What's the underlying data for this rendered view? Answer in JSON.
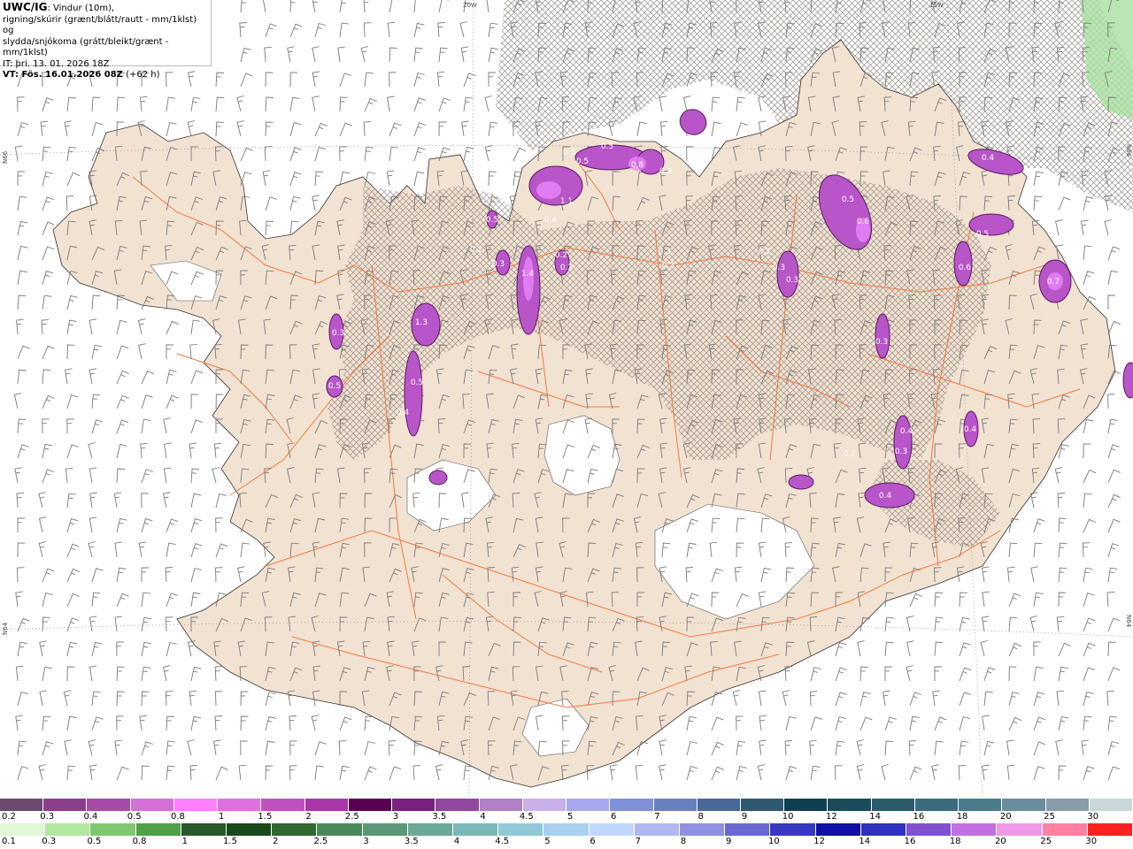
{
  "header": {
    "code": "UWC/IG",
    "line1_rest": ": Vindur (10m),",
    "line2": "rigning/skúrir (grænt/blátt/rautt - mm/1klst) og",
    "line3": "slydda/snjókoma (grátt/bleikt/grænt - mm/1klst)",
    "it": "IT: þri. 13. 01. 2026 18Z",
    "vt_label": "VT: Fös. 16.01.2026 08Z",
    "vt_offset": " (+62 h)"
  },
  "graticule_labels": {
    "top_left_lon": "20W",
    "top_right_lon": "15W",
    "left_top_lat": "N66",
    "left_bottom_lat": "N64",
    "right_top_lat": "N66",
    "right_bottom_lat": "N64"
  },
  "precip_labels": [
    {
      "text": "0.5"
    },
    {
      "text": "0.5"
    },
    {
      "text": "0.5"
    },
    {
      "text": "0.8"
    },
    {
      "text": "0.3"
    },
    {
      "text": "1.1"
    },
    {
      "text": "0.4"
    },
    {
      "text": "0.5"
    },
    {
      "text": "0.3"
    },
    {
      "text": "1.4"
    },
    {
      "text": "0.2"
    },
    {
      "text": "0.3"
    },
    {
      "text": "0.2"
    },
    {
      "text": "0.3"
    },
    {
      "text": "0.3"
    },
    {
      "text": "1.3"
    },
    {
      "text": "0.5"
    },
    {
      "text": "0.3"
    },
    {
      "text": "0.5"
    },
    {
      "text": "0.4"
    },
    {
      "text": "0.5"
    },
    {
      "text": "0.6"
    },
    {
      "text": "0.4"
    },
    {
      "text": "0.4"
    },
    {
      "text": "0.5"
    },
    {
      "text": "0.6"
    },
    {
      "text": "0.7"
    },
    {
      "text": "0.3"
    },
    {
      "text": "0.3"
    },
    {
      "text": "0.2"
    },
    {
      "text": "0.3"
    },
    {
      "text": "0.4"
    },
    {
      "text": "0.4"
    },
    {
      "text": "0.3"
    },
    {
      "text": "0.2"
    }
  ],
  "legend_snow": {
    "ticks": [
      "0.2",
      "0.3",
      "0.4",
      "0.5",
      "0.8",
      "1",
      "1.5",
      "2",
      "2.5",
      "3",
      "3.5",
      "4",
      "4.5",
      "5",
      "6",
      "7",
      "8",
      "9",
      "10",
      "12",
      "14",
      "16",
      "18",
      "20",
      "25",
      "30"
    ],
    "colors": [
      "#6b4a6e",
      "#8a3e8c",
      "#a64aa8",
      "#d470d8",
      "#ff80ff",
      "#e070e0",
      "#c050c0",
      "#a838a8",
      "#5a0050",
      "#7a2080",
      "#9048a0",
      "#b080c8",
      "#c8b0e8",
      "#a8a8f0",
      "#8090d8",
      "#6880c0",
      "#486898",
      "#305870",
      "#104050",
      "#1a4c5c",
      "#2a5c6c",
      "#3a6c7c",
      "#4a7c8c",
      "#6a8c9c",
      "#8a9ca8",
      "#c8d8d8"
    ]
  },
  "legend_rain": {
    "ticks": [
      "0.1",
      "0.3",
      "0.5",
      "0.8",
      "1",
      "1.5",
      "2",
      "2.5",
      "3",
      "3.5",
      "4",
      "4.5",
      "5",
      "6",
      "7",
      "8",
      "9",
      "10",
      "12",
      "14",
      "16",
      "18",
      "20",
      "25",
      "30"
    ],
    "colors": [
      "#e0f8d8",
      "#b0e8a0",
      "#80c870",
      "#50a048",
      "#285828",
      "#1a4a1a",
      "#306830",
      "#4a8858",
      "#5a9878",
      "#6aa898",
      "#7ab8b8",
      "#90c8d8",
      "#a8d0f0",
      "#c0d8ff",
      "#b0b8f0",
      "#9090e0",
      "#6868d0",
      "#3838c0",
      "#1010a8",
      "#3030c0",
      "#8050d0",
      "#c070e0",
      "#f098e8",
      "#ff80a0",
      "#ff2020"
    ]
  },
  "colors": {
    "land": "#f2e2d2",
    "ice": "#ffffff",
    "sea": "#ffffff",
    "roads": "#ef7a40",
    "precip_light": "#b855c8",
    "precip_heavy": "#7a2a88",
    "wind_barb": "#7a7a7a"
  }
}
